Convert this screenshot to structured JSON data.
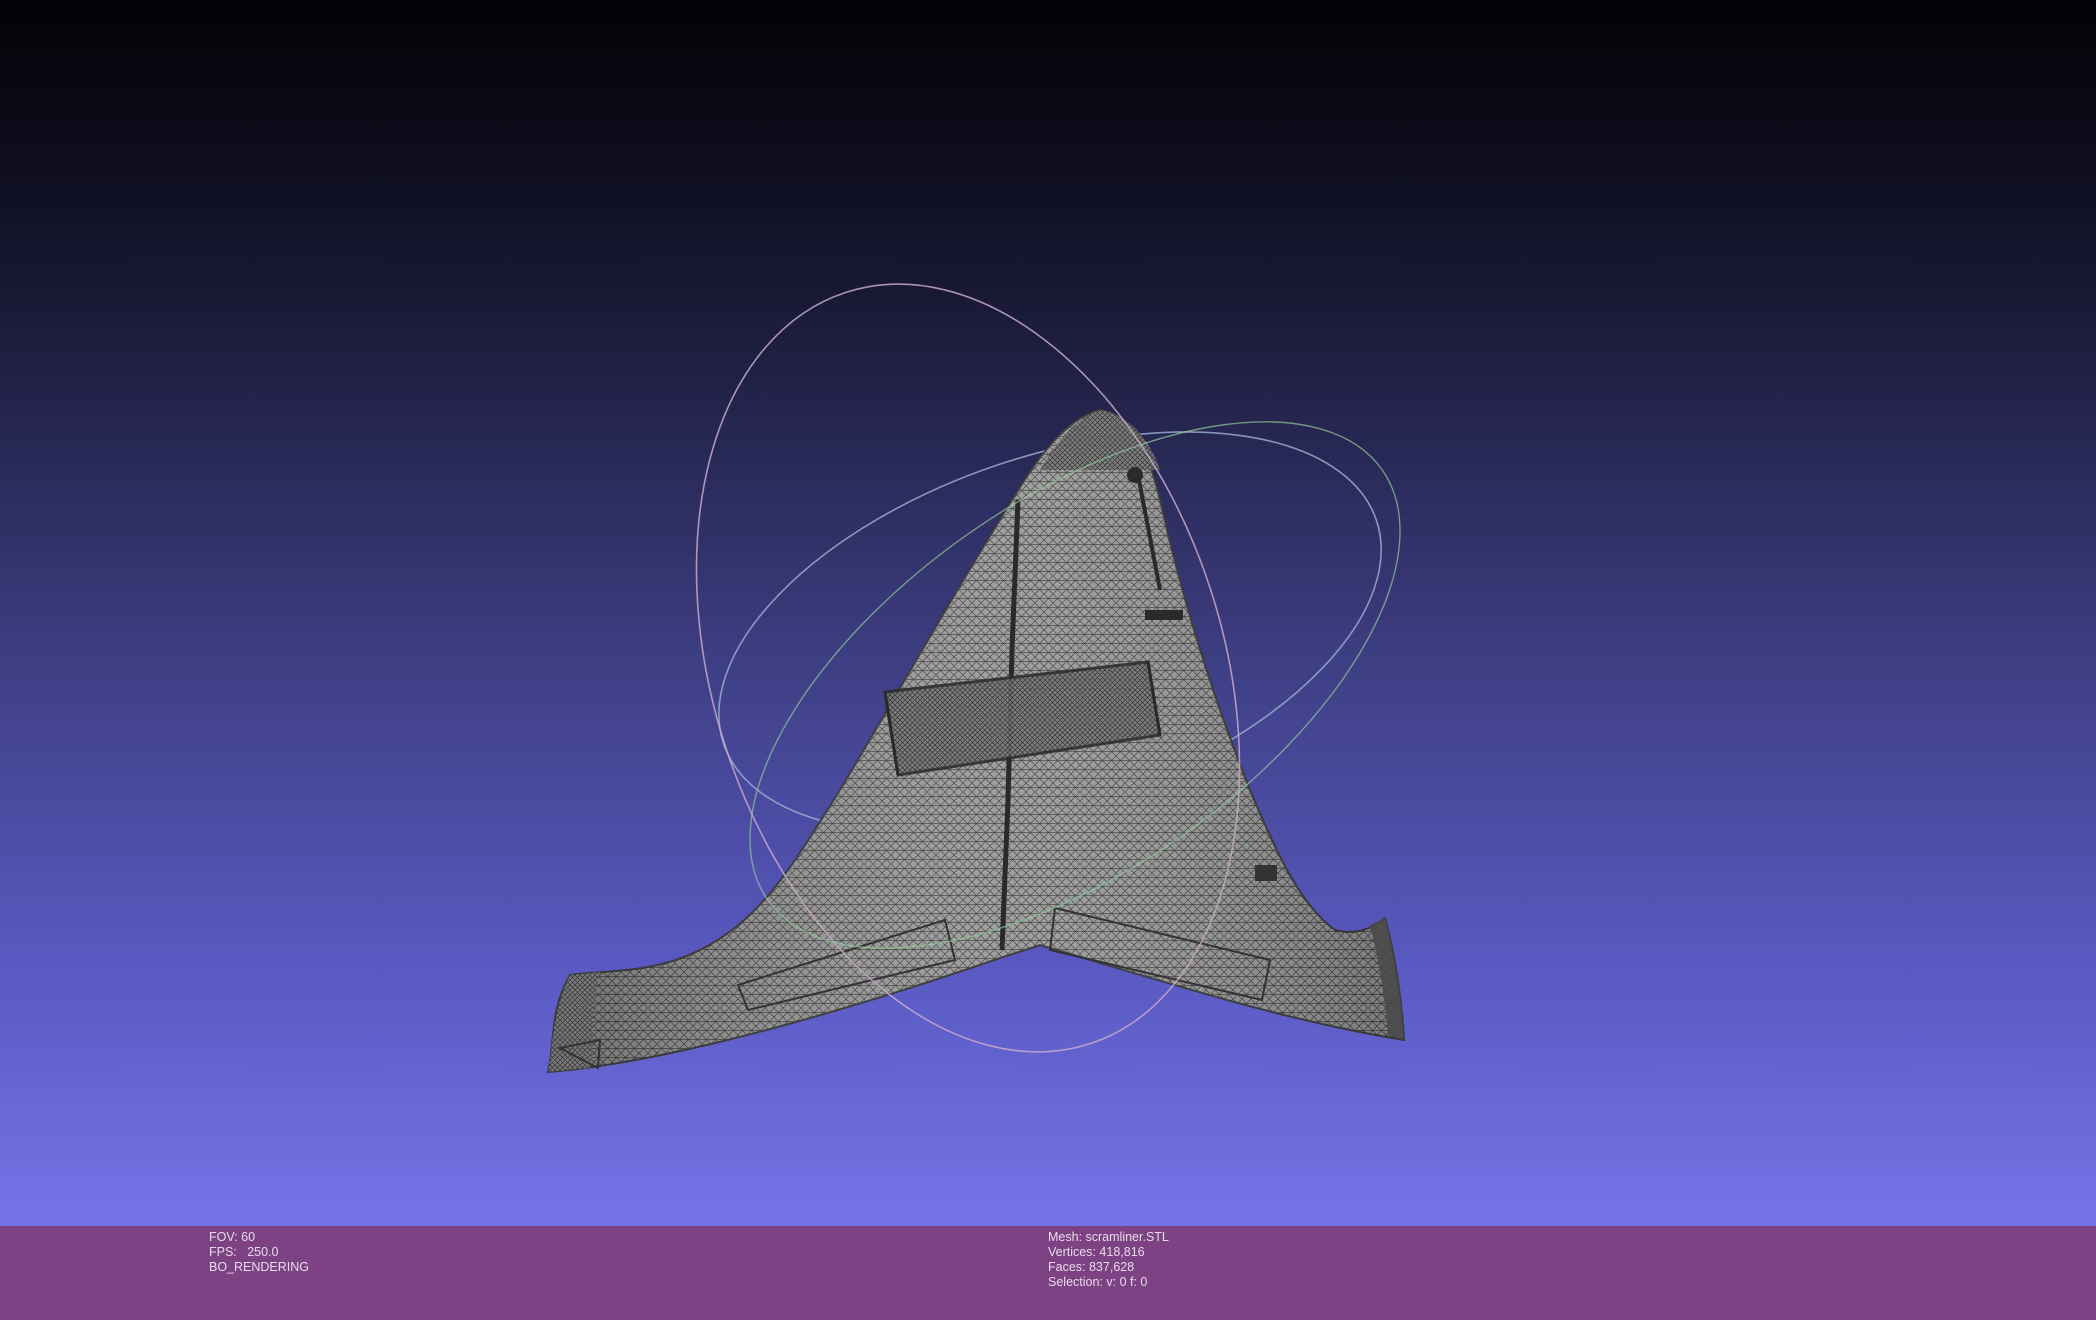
{
  "viewport": {
    "background_top": "#020205",
    "background_bottom": "#7474e8",
    "mesh_fill": "#8f8f8f",
    "mesh_wire": "#3a3a3a",
    "trackball_colors": [
      "#c7a8c8",
      "#9fb4d0",
      "#8fc99a"
    ]
  },
  "info": {
    "left": {
      "fov": "FOV: 60",
      "fps": "FPS:   250.0",
      "mode": "BO_RENDERING"
    },
    "right": {
      "mesh": "Mesh: scramliner.STL",
      "vertices": "Vertices: 418,816",
      "faces": "Faces: 837,628",
      "selection": "Selection: v: 0 f: 0"
    }
  }
}
